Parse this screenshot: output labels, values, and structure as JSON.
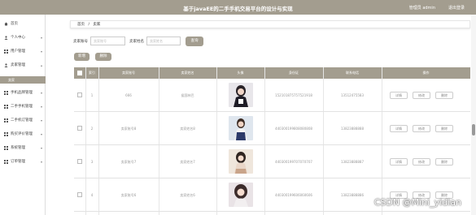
{
  "header": {
    "title": "基于javaEE的二手手机交易平台的设计与实现",
    "admin_label": "管理员 admin",
    "logout_label": "退出登录"
  },
  "sidebar": {
    "items": [
      {
        "label": "首页",
        "icon": "home-icon",
        "has_arrow": false
      },
      {
        "label": "个人中心",
        "icon": "user-icon",
        "has_arrow": true
      },
      {
        "label": "用户管理",
        "icon": "grid-icon",
        "has_arrow": true
      },
      {
        "label": "卖家管理",
        "icon": "user-icon",
        "has_arrow": true
      },
      {
        "label": "手机品牌管理",
        "icon": "grid-icon",
        "has_arrow": true
      },
      {
        "label": "二手手机管理",
        "icon": "grid-icon",
        "has_arrow": true
      },
      {
        "label": "二手机订管理",
        "icon": "grid-icon",
        "has_arrow": true
      },
      {
        "label": "购买评价管理",
        "icon": "grid-icon",
        "has_arrow": true
      },
      {
        "label": "系统管理",
        "icon": "grid-icon",
        "has_arrow": true
      },
      {
        "label": "订单管理",
        "icon": "grid-icon",
        "has_arrow": true
      }
    ],
    "sub_active": "卖家"
  },
  "breadcrumb": {
    "home": "首页",
    "sep": "/",
    "current": "卖家"
  },
  "search": {
    "seller_account_label": "卖家账号",
    "seller_account_placeholder": "卖家账号",
    "seller_name_label": "卖家姓名",
    "seller_name_placeholder": "卖家姓名",
    "search_button": "查询"
  },
  "actions": {
    "add": "新增",
    "delete": "删除"
  },
  "table": {
    "headers": [
      "",
      "索引",
      "卖家账号",
      "卖家姓名",
      "头像",
      "身份证",
      "联系电话",
      "操作"
    ],
    "rows": [
      {
        "index": "1",
        "account": "666",
        "name": "侯国林巴",
        "id_card": "152101875757521918",
        "phone": "13512475583"
      },
      {
        "index": "2",
        "account": "卖家账号8",
        "name": "卖家姓名8",
        "id_card": "440300199808080808",
        "phone": "13823888888"
      },
      {
        "index": "3",
        "account": "卖家账号7",
        "name": "卖家姓名7",
        "id_card": "440300199707070707",
        "phone": "13823888887"
      },
      {
        "index": "4",
        "account": "卖家账号6",
        "name": "卖家姓名6",
        "id_card": "440300199606060606",
        "phone": "13823888886"
      }
    ],
    "row_buttons": {
      "detail": "详情",
      "edit": "修改",
      "delete": "删除"
    }
  },
  "watermark": "CSDN @Mini_yidian",
  "colors": {
    "accent": "#a39d8f"
  }
}
